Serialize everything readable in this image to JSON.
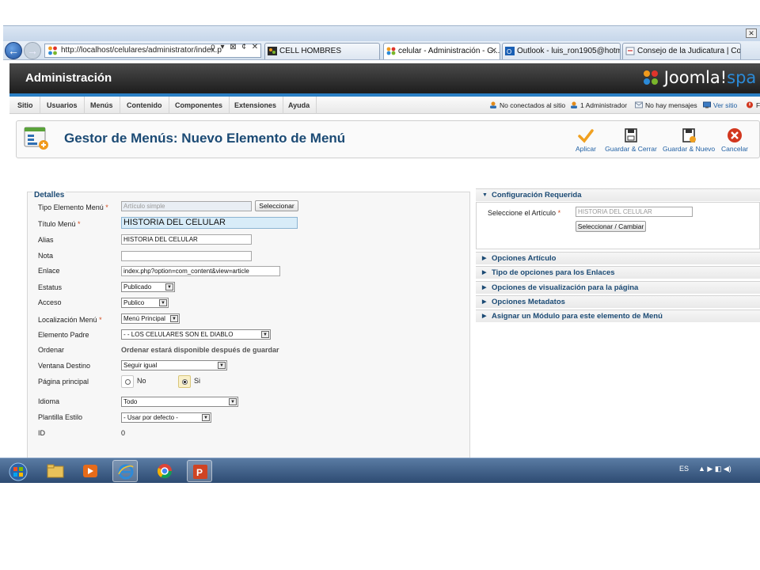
{
  "browser": {
    "address": "http://localhost/celulares/administrator/index.p",
    "address_tools": "ρ ▾ ⊠ ¢ ✕",
    "tabs": [
      {
        "label": "CELL HOMBRES",
        "close": ""
      },
      {
        "label": "celular - Administración - G...",
        "close": "✕"
      },
      {
        "label": "Outlook - luis_ron1905@hotm...",
        "close": ""
      },
      {
        "label": "Consejo de la Judicatura | Con...",
        "close": ""
      }
    ],
    "window_close": "✕"
  },
  "header": {
    "title": "Administración",
    "logo_text": "Joomla!",
    "logo_suffix": "spa"
  },
  "menubar": {
    "items": [
      "Sitio",
      "Usuarios",
      "Menús",
      "Contenido",
      "Componentes",
      "Extensiones",
      "Ayuda"
    ],
    "status": {
      "no_conectados": "No conectados al sitio",
      "administrador": "1 Administrador",
      "mensajes": "No hay mensajes",
      "ver_sitio": "Ver sitio",
      "fi": "Fi"
    }
  },
  "toolbar": {
    "title": "Gestor de Menús: Nuevo Elemento de Menú",
    "buttons": {
      "aplicar": "Aplicar",
      "guardar_cerrar": "Guardar & Cerrar",
      "guardar_nuevo": "Guardar & Nuevo",
      "cancelar": "Cancelar"
    }
  },
  "detalles": {
    "legend": "Detalles",
    "required_mark": "*",
    "fields": {
      "tipo": {
        "label": "Tipo Elemento Menú",
        "value": "Artículo simple",
        "button": "Seleccionar"
      },
      "titulo": {
        "label": "Título Menú",
        "value": "HISTORIA DEL CELULAR"
      },
      "alias": {
        "label": "Alias",
        "value": "HISTORIA DEL CELULAR"
      },
      "nota": {
        "label": "Nota",
        "value": ""
      },
      "enlace": {
        "label": "Enlace",
        "value": "index.php?option=com_content&view=article"
      },
      "estatus": {
        "label": "Estatus",
        "value": "Publicado"
      },
      "acceso": {
        "label": "Acceso",
        "value": "Publico"
      },
      "localizacion": {
        "label": "Localización Menú",
        "value": "Menú Principal"
      },
      "padre": {
        "label": "Elemento Padre",
        "value": "- - LOS CELULARES SON EL DIABLO"
      },
      "ordenar": {
        "label": "Ordenar",
        "value": "Ordenar estará disponible después de guardar"
      },
      "ventana": {
        "label": "Ventana Destino",
        "value": "Seguir igual"
      },
      "pagina_principal": {
        "label": "Página principal",
        "no": "No",
        "si": "Si"
      },
      "idioma": {
        "label": "Idioma",
        "value": "Todo"
      },
      "plantilla": {
        "label": "Plantilla Estilo",
        "value": "- Usar por defecto -"
      },
      "id": {
        "label": "ID",
        "value": "0"
      }
    }
  },
  "right_panel": {
    "config": {
      "header": "Configuración Requerida",
      "articulo_label": "Seleccione el Artículo",
      "articulo_value": "HISTORIA DEL CELULAR",
      "button": "Seleccionar / Cambiar"
    },
    "sections": [
      "Opciones Artículo",
      "Tipo de opciones para los Enlaces",
      "Opciones de visualización para la página",
      "Opciones Metadatos",
      "Asignar un Módulo para este elemento de Menú"
    ]
  },
  "taskbar": {
    "lang": "ES",
    "tray_icons": "▲  ▶  ◧  ◀)"
  }
}
